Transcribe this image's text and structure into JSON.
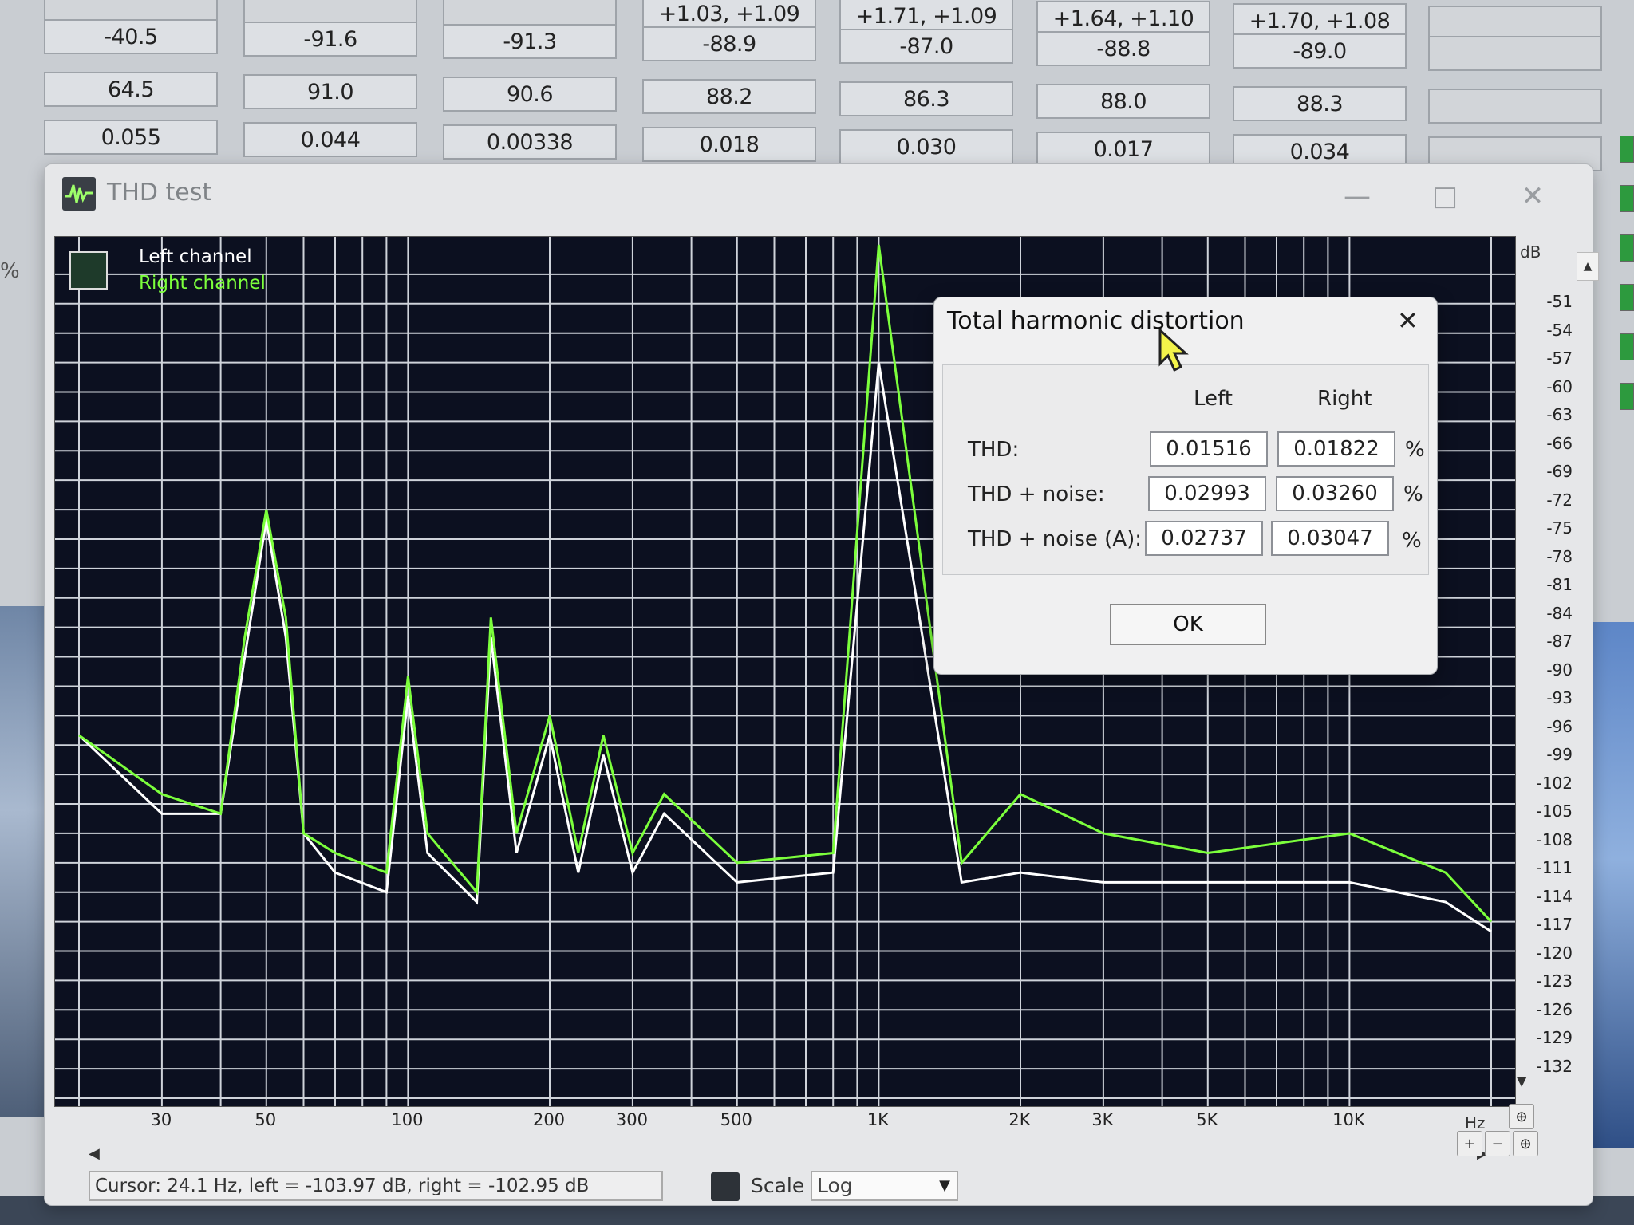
{
  "top_table": {
    "row0": [
      "",
      "",
      "",
      "+1.03, +1.09",
      "+1.71, +1.09",
      "+1.64, +1.10",
      "+1.70, +1.08",
      ""
    ],
    "row1": [
      "-40.5",
      "-91.6",
      "-91.3",
      "-88.9",
      "-87.0",
      "-88.8",
      "-89.0",
      ""
    ],
    "row2": [
      "64.5",
      "91.0",
      "90.6",
      "88.2",
      "86.3",
      "88.0",
      "88.3",
      ""
    ],
    "row3": [
      "0.055",
      "0.044",
      "0.00338",
      "0.018",
      "0.030",
      "0.017",
      "0.034",
      ""
    ]
  },
  "left_edge_text": "%",
  "window": {
    "title": "THD test",
    "icon": "waveform-icon",
    "controls": [
      "minimize-icon",
      "maximize-icon",
      "close-icon"
    ]
  },
  "legend": {
    "left": "Left channel",
    "right": "Right channel",
    "left_color": "#ffffff",
    "right_color": "#7cff3c"
  },
  "db_axis": {
    "unit": "dB",
    "ticks": [
      "-51",
      "-54",
      "-57",
      "-60",
      "-63",
      "-66",
      "-69",
      "-72",
      "-75",
      "-78",
      "-81",
      "-84",
      "-87",
      "-90",
      "-93",
      "-96",
      "-99",
      "-102",
      "-105",
      "-108",
      "-111",
      "-114",
      "-117",
      "-120",
      "-123",
      "-126",
      "-129",
      "-132"
    ]
  },
  "hz_axis": {
    "unit": "Hz",
    "ticks": [
      "30",
      "50",
      "100",
      "200",
      "300",
      "500",
      "1K",
      "2K",
      "3K",
      "5K",
      "10K"
    ]
  },
  "chart_data": {
    "type": "line",
    "x_scale": "log",
    "xlim": [
      20,
      20000
    ],
    "ylim": [
      -135,
      -48
    ],
    "series": [
      {
        "name": "Left channel",
        "color": "#ffffff",
        "x": [
          20,
          30,
          40,
          45,
          50,
          55,
          60,
          70,
          90,
          100,
          110,
          140,
          150,
          170,
          200,
          230,
          260,
          300,
          350,
          500,
          800,
          1000,
          1500,
          2000,
          3000,
          5000,
          10000,
          16000,
          20000
        ],
        "y": [
          -98,
          -106,
          -106,
          -90,
          -76,
          -88,
          -108,
          -112,
          -114,
          -94,
          -110,
          -115,
          -88,
          -110,
          -98,
          -112,
          -100,
          -112,
          -106,
          -113,
          -112,
          -60,
          -113,
          -112,
          -113,
          -113,
          -113,
          -115,
          -118
        ]
      },
      {
        "name": "Right channel",
        "color": "#7cff3c",
        "x": [
          20,
          30,
          40,
          45,
          50,
          55,
          60,
          70,
          90,
          100,
          110,
          140,
          150,
          170,
          200,
          230,
          260,
          300,
          350,
          500,
          800,
          1000,
          1500,
          2000,
          3000,
          5000,
          10000,
          16000,
          20000
        ],
        "y": [
          -98,
          -104,
          -106,
          -88,
          -75,
          -86,
          -108,
          -110,
          -112,
          -92,
          -108,
          -114,
          -86,
          -108,
          -96,
          -110,
          -98,
          -110,
          -104,
          -111,
          -110,
          -48,
          -111,
          -104,
          -108,
          -110,
          -108,
          -112,
          -117
        ]
      }
    ]
  },
  "dialog": {
    "title": "Total harmonic distortion",
    "col_left": "Left",
    "col_right": "Right",
    "rows": [
      {
        "label": "THD:",
        "left": "0.01516",
        "right": "0.01822",
        "unit": "%"
      },
      {
        "label": "THD + noise:",
        "left": "0.02993",
        "right": "0.03260",
        "unit": "%"
      },
      {
        "label": "THD + noise (A):",
        "left": "0.02737",
        "right": "0.03047",
        "unit": "%"
      }
    ],
    "ok_label": "OK"
  },
  "status": {
    "cursor_text": "Cursor: 24.1 Hz,  left = -103.97 dB,  right = -102.95 dB",
    "scale_label": "Scale",
    "scale_value": "Log"
  }
}
